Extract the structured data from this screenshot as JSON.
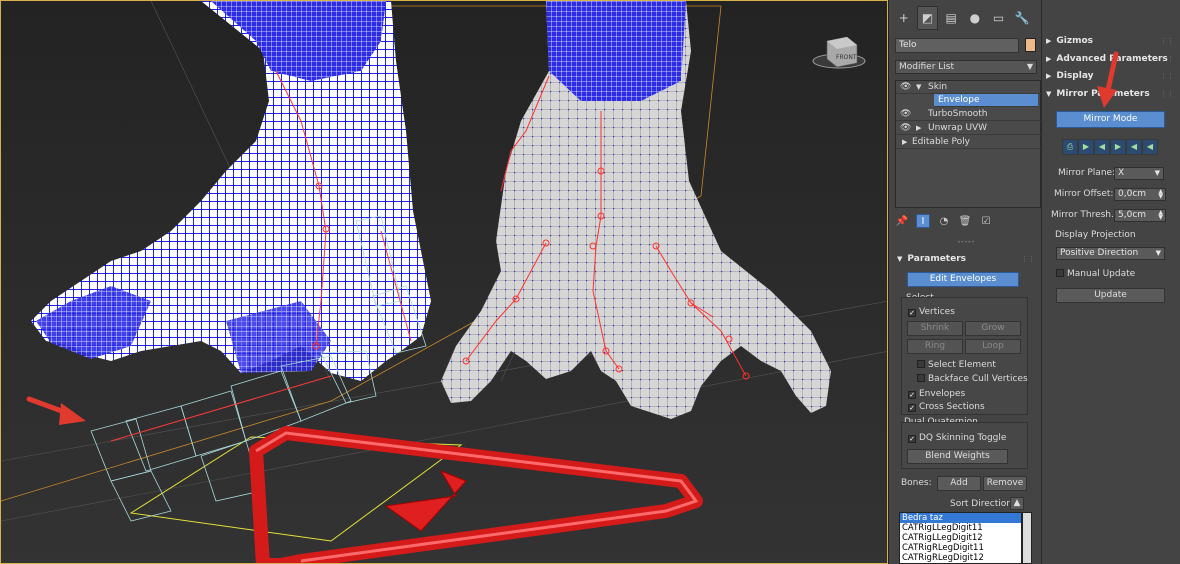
{
  "toolbar": {
    "tabs": [
      "create-icon",
      "modify-icon",
      "hierarchy-icon",
      "motion-icon",
      "display-icon",
      "utilities-icon"
    ]
  },
  "object": {
    "name": "Telo",
    "color": "#f0b98a"
  },
  "modifier_list": {
    "label": "Modifier List"
  },
  "stack": {
    "skin": "Skin",
    "envelope": "Envelope",
    "turbosmooth": "TurboSmooth",
    "unwrap": "Unwrap UVW",
    "editable_poly": "Editable Poly"
  },
  "parameters": {
    "title": "Parameters",
    "edit_envelopes": "Edit Envelopes",
    "select_label": "Select",
    "vertices": "Vertices",
    "shrink": "Shrink",
    "grow": "Grow",
    "ring": "Ring",
    "loop": "Loop",
    "select_element": "Select Element",
    "backface": "Backface Cull Vertices",
    "envelopes": "Envelopes",
    "cross_sections": "Cross Sections",
    "dual_quaternion": "Dual Quaternion",
    "dq_toggle": "DQ Skinning Toggle",
    "blend_weights": "Blend Weights",
    "bones_label": "Bones:",
    "add": "Add",
    "remove": "Remove",
    "sort_direction": "Sort Direction:",
    "bones": [
      "Bedra taz",
      "CATRigLLegDigit11",
      "CATRigLLegDigit12",
      "CATRigRLegDigit11",
      "CATRigRLegDigit12"
    ]
  },
  "side": {
    "gizmos": "Gizmos",
    "advanced": "Advanced Parameters",
    "display": "Display",
    "mirror_params": "Mirror Parameters",
    "mirror_mode": "Mirror Mode",
    "mirror_plane_label": "Mirror Plane:",
    "mirror_plane_value": "X",
    "mirror_offset_label": "Mirror Offset:",
    "mirror_offset_value": "0,0cm",
    "mirror_thresh_label": "Mirror Thresh.:",
    "mirror_thresh_value": "5,0cm",
    "display_projection": "Display Projection",
    "projection_value": "Positive Direction",
    "manual_update": "Manual Update",
    "update": "Update"
  },
  "colors": {
    "accent": "#5a8ed0",
    "panel": "#444444",
    "arrow": "#e03a2f",
    "mesh": "#2020e0"
  }
}
